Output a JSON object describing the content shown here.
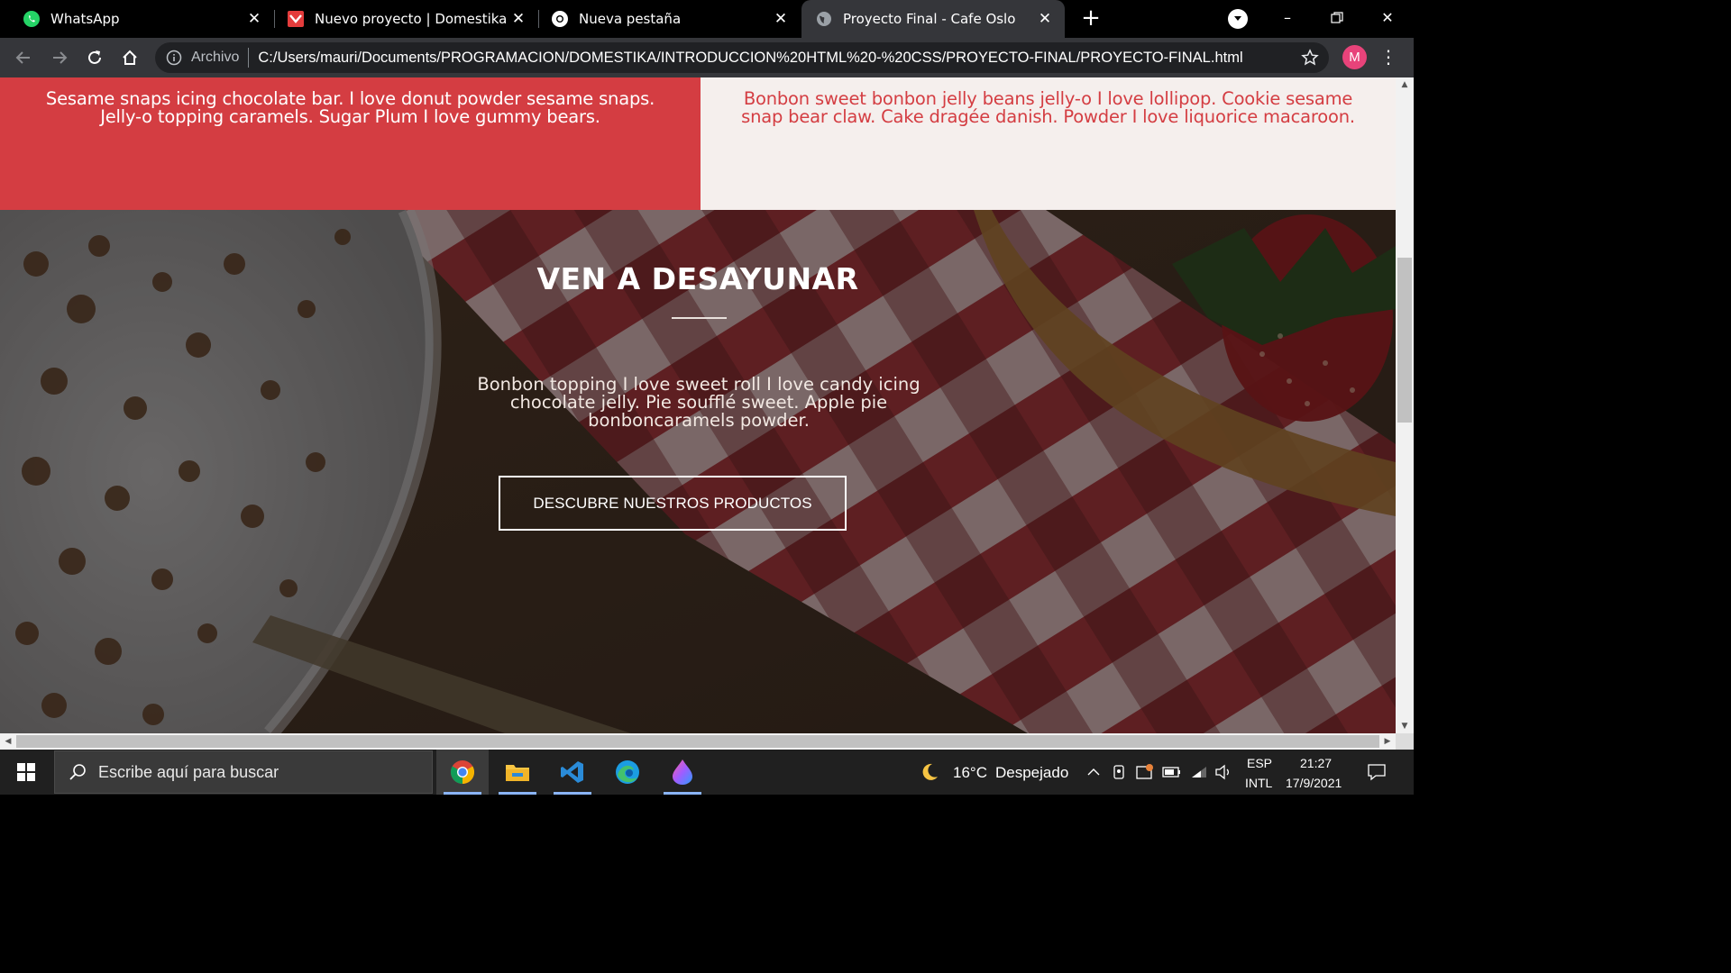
{
  "browser": {
    "tabs": [
      {
        "title": "WhatsApp",
        "icon": "whatsapp-icon",
        "active": false
      },
      {
        "title": "Nuevo proyecto | Domestika",
        "icon": "domestika-icon",
        "active": false
      },
      {
        "title": "Nueva pestaña",
        "icon": "chrome-icon",
        "active": false
      },
      {
        "title": "Proyecto Final - Cafe Oslo",
        "icon": "globe-icon",
        "active": true
      }
    ],
    "new_tab_label": "+",
    "address": {
      "scheme_label": "Archivo",
      "url": "C:/Users/mauri/Documents/PROGRAMACION/DOMESTIKA/INTRODUCCION%20HTML%20-%20CSS/PROYECTO-FINAL/PROYECTO-FINAL.html"
    },
    "profile_initial": "M"
  },
  "page": {
    "panel_left_text": "Sesame snaps icing chocolate bar. I love donut powder sesame snaps. Jelly-o topping caramels. Sugar Plum I love gummy bears.",
    "panel_right_text": "Bonbon sweet bonbon jelly beans jelly-o I love lollipop. Cookie sesame snap bear claw. Cake dragée danish. Powder I love liquorice macaroon.",
    "hero": {
      "title": "VEN A DESAYUNAR",
      "text": "Bonbon topping I love sweet roll I love candy icing chocolate jelly. Pie soufflé sweet. Apple pie bonboncaramels powder.",
      "button_label": "DESCUBRE NUESTROS PRODUCTOS"
    },
    "colors": {
      "accent_red": "#d43d42",
      "light_panel": "#f5efed"
    }
  },
  "taskbar": {
    "search_placeholder": "Escribe aquí para buscar",
    "pinned_apps": [
      "chrome-icon",
      "file-explorer-icon",
      "vscode-icon",
      "edge-icon",
      "paint-drop-icon"
    ],
    "weather": {
      "temp": "16°C",
      "condition": "Despejado"
    },
    "language": {
      "top": "ESP",
      "bottom": "INTL"
    },
    "clock": {
      "time": "21:27",
      "date": "17/9/2021"
    }
  }
}
